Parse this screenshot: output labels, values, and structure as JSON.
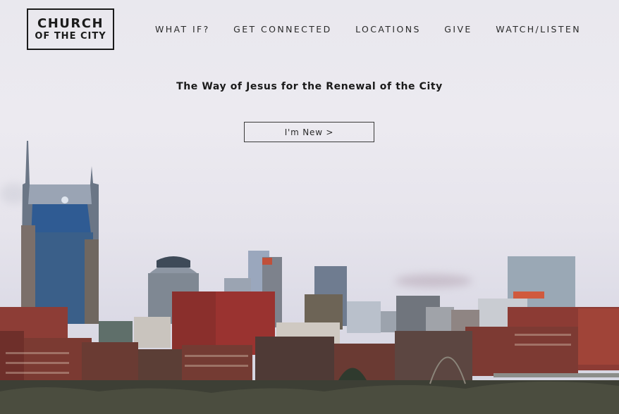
{
  "logo": {
    "line1": "CHURCH",
    "line2": "OF THE CITY"
  },
  "nav": {
    "items": [
      {
        "label": "WHAT IF?"
      },
      {
        "label": "GET CONNECTED"
      },
      {
        "label": "LOCATIONS"
      },
      {
        "label": "GIVE"
      },
      {
        "label": "WATCH/LISTEN"
      }
    ]
  },
  "hero": {
    "tagline": "The Way of Jesus for the Renewal of the City",
    "cta_label": "I'm New >"
  },
  "colors": {
    "text": "#1b1b1b",
    "sky": "#e9e8ee",
    "brick": "#8a2f2c"
  }
}
